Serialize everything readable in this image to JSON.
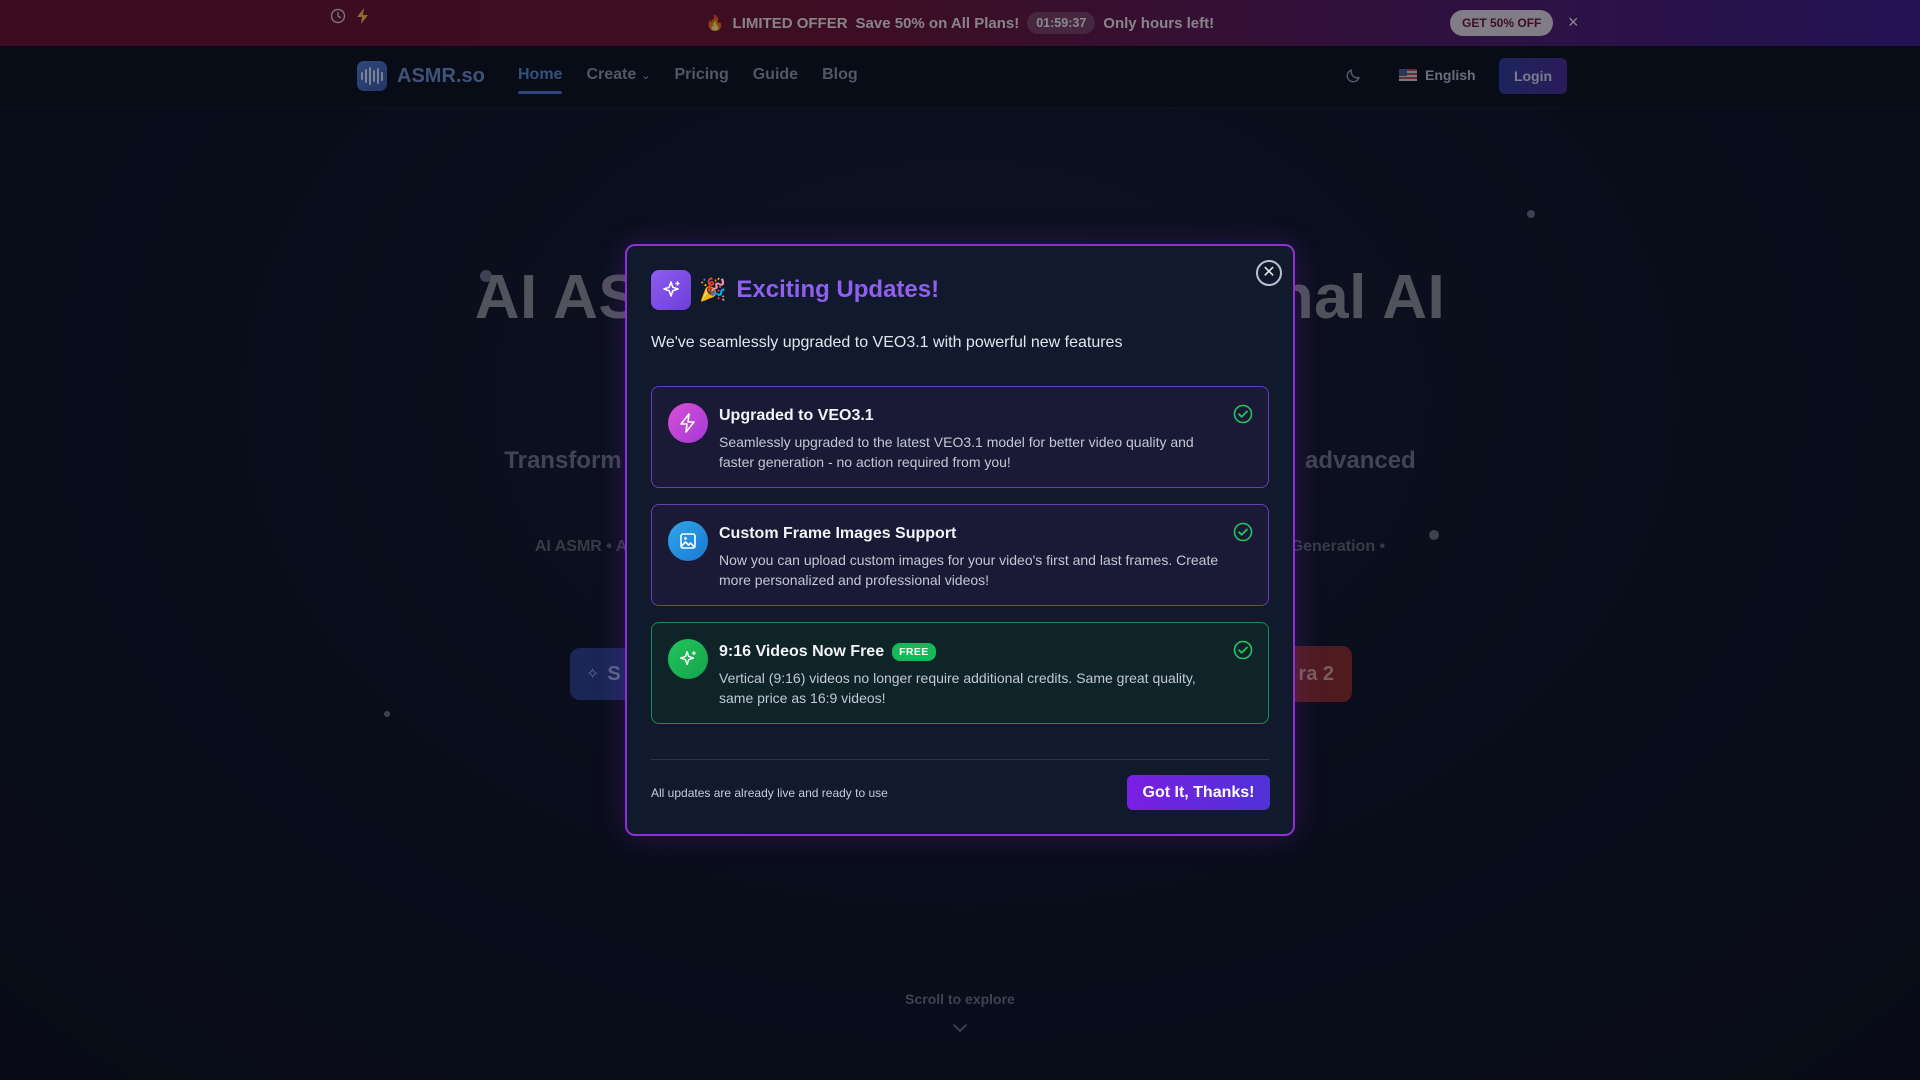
{
  "promo": {
    "offer_emoji": "🔥",
    "offer_title": "LIMITED OFFER",
    "offer_text": "Save 50% on All Plans!",
    "timer": "01:59:37",
    "hurry_text": "Only hours left!",
    "cta_label": "GET 50% OFF",
    "close_glyph": "×"
  },
  "nav": {
    "logo_text": "ASMR.so",
    "links": [
      {
        "label": "Home",
        "active": true
      },
      {
        "label": "Create",
        "has_dropdown": true
      },
      {
        "label": "Pricing"
      },
      {
        "label": "Guide"
      },
      {
        "label": "Blog"
      }
    ],
    "language": "English",
    "login_label": "Login"
  },
  "hero": {
    "title_left": "AI AS",
    "title_right": "nal AI",
    "subtitle_left": "Transform",
    "subtitle_right": "advanced",
    "tags_left": "AI ASMR • AI",
    "tags_right": "Generation •",
    "button_left_label": "S",
    "button_right_label": "ra 2",
    "scroll_label": "Scroll to explore"
  },
  "modal": {
    "emoji": "🎉",
    "title": "Exciting Updates!",
    "description": "We've seamlessly upgraded to VEO3.1 with powerful new features",
    "close_glyph": "✕",
    "features": [
      {
        "title": "Upgraded to VEO3.1",
        "text": "Seamlessly upgraded to the latest VEO3.1 model for better video quality and faster generation - no action required from you!",
        "icon": "lightning-icon"
      },
      {
        "title": "Custom Frame Images Support",
        "text": "Now you can upload custom images for your video's first and last frames. Create more personalized and professional videos!",
        "icon": "image-icon"
      },
      {
        "title": "9:16 Videos Now Free",
        "badge": "FREE",
        "text": "Vertical (9:16) videos no longer require additional credits. Same great quality, same price as 16:9 videos!",
        "icon": "sparkles-icon"
      }
    ],
    "footnote": "All updates are already live and ready to use",
    "confirm_label": "Got It, Thanks!"
  },
  "colors": {
    "accent_purple": "#8b2fd6",
    "success_green": "#22c55e",
    "primary_blue": "#4c78d0"
  }
}
